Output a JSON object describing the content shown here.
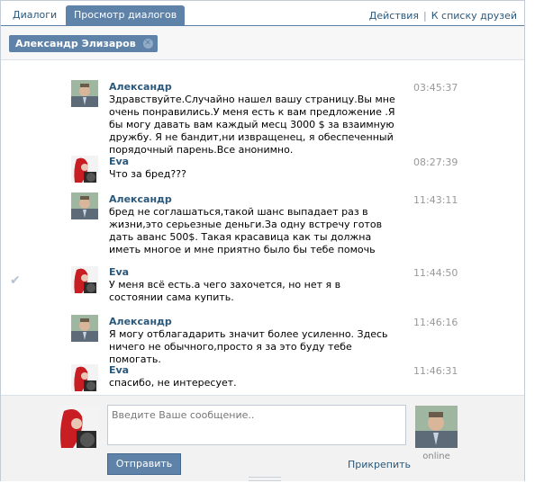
{
  "tabs": [
    {
      "label": "Диалоги"
    },
    {
      "label": "Просмотр диалогов"
    }
  ],
  "top_links": {
    "actions": "Действия",
    "separator": "|",
    "friends": "К списку друзей"
  },
  "recipient": {
    "name": "Александр Элизаров",
    "remove_icon": "close-icon"
  },
  "messages": [
    {
      "author": "Александр",
      "time": "03:45:37",
      "text": "Здравствуйте.Случайно нашел вашу страницу.Вы мне очень понравились.У меня есть к вам предложение .Я бы могу давать вам каждый месц 3000 $ за взаимную дружбу. Я не бандит,ни извращенец, я обеспеченный порядочный парень.Все анонимно."
    },
    {
      "author": "Eva",
      "time": "08:27:39",
      "text": "Что за бред???"
    },
    {
      "author": "Александр",
      "time": "11:43:11",
      "text": "бред не соглашаться,такой шанс выпадает раз в жизни,это серьезные деньги.За одну встречу готов дать аванс 500$. Такая красавица как ты должна иметь многое и мне приятно было бы тебе помочь"
    },
    {
      "author": "Eva",
      "time": "11:44:50",
      "text": "У меня всё есть.а чего захочется, но нет я в состоянии сама купить.",
      "read_icon": "checkmark-icon"
    },
    {
      "author": "Александр",
      "time": "11:46:16",
      "text": "Я могу отблагадарить значит более усиленно. Здесь ничего не обычного,просто я за это буду тебе помогать."
    },
    {
      "author": "Eva",
      "time": "11:46:31",
      "text": "спасибо, не интересует."
    }
  ],
  "compose": {
    "placeholder": "Введите Ваше сообщение..",
    "send_label": "Отправить",
    "attach_label": "Прикрепить",
    "peer_status": "online"
  },
  "colors": {
    "accent": "#5e82a8",
    "link": "#2b587a",
    "time": "#999999"
  }
}
